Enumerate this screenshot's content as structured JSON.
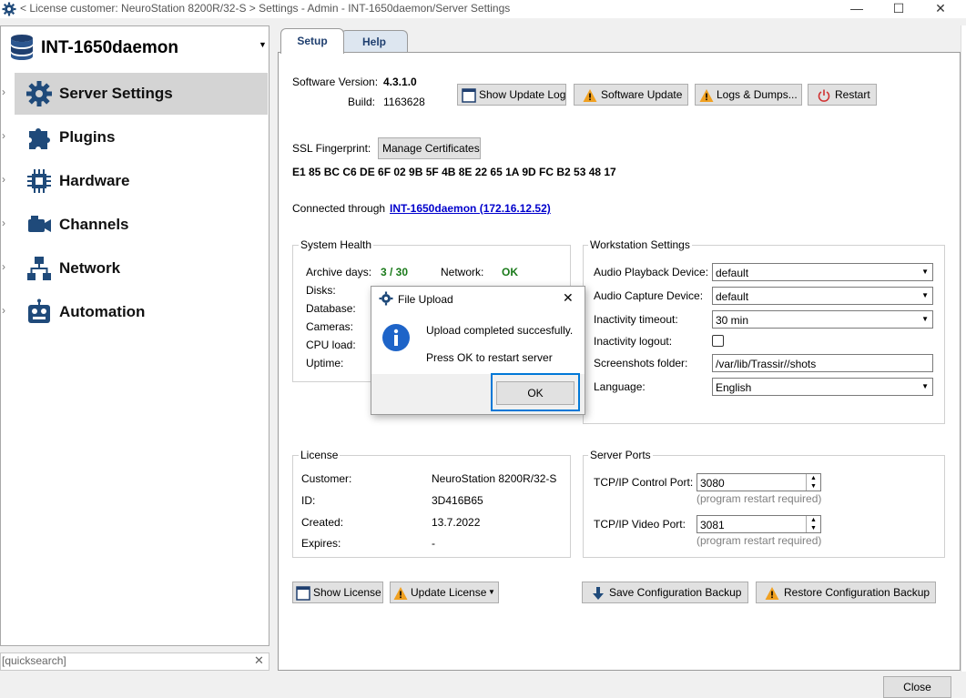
{
  "window": {
    "title": "< License customer: NeuroStation 8200R/32-S > Settings - Admin - INT-1650daemon/Server Settings",
    "minimize": "—",
    "maximize": "☐",
    "close": "✕"
  },
  "sidebar": {
    "server_name": "INT-1650daemon",
    "items": [
      {
        "label": "Server Settings",
        "icon": "gear-icon",
        "active": true
      },
      {
        "label": "Plugins",
        "icon": "puzzle-icon"
      },
      {
        "label": "Hardware",
        "icon": "chip-icon"
      },
      {
        "label": "Channels",
        "icon": "camera-icon"
      },
      {
        "label": "Network",
        "icon": "network-icon"
      },
      {
        "label": "Automation",
        "icon": "robot-icon"
      }
    ],
    "quicksearch_placeholder": "[quicksearch]",
    "quicksearch_clear": "✕"
  },
  "tabs": [
    {
      "label": "Setup",
      "active": true
    },
    {
      "label": "Help"
    }
  ],
  "setup": {
    "software_version_label": "Software Version:",
    "software_version": "4.3.1.0",
    "build_label": "Build:",
    "build": "1163628",
    "buttons": {
      "show_update_log": "Show Update Log",
      "software_update": "Software Update",
      "logs_dumps": "Logs & Dumps...",
      "restart": "Restart"
    },
    "ssl_label": "SSL Fingerprint:",
    "manage_certificates": "Manage Certificates",
    "ssl_fingerprint": "E1 85 BC C6 DE 6F 02 9B 5F 4B 8E 22 65 1A 9D FC B2 53 48 17",
    "connected_label": "Connected through",
    "connected_link": "INT-1650daemon (172.16.12.52)",
    "system_health": {
      "title": "System Health",
      "archive_days_label": "Archive days:",
      "archive_days": "3 / 30",
      "network_label": "Network:",
      "network": "OK",
      "disks_label": "Disks:",
      "database_label": "Database:",
      "cameras_label": "Cameras:",
      "cpu_label": "CPU load:",
      "uptime_label": "Uptime:"
    },
    "workstation": {
      "title": "Workstation Settings",
      "audio_playback_label": "Audio Playback Device:",
      "audio_playback": "default",
      "audio_capture_label": "Audio Capture Device:",
      "audio_capture": "default",
      "inactivity_timeout_label": "Inactivity timeout:",
      "inactivity_timeout": "30 min",
      "inactivity_logout_label": "Inactivity logout:",
      "screenshots_label": "Screenshots folder:",
      "screenshots_folder": "/var/lib/Trassir//shots",
      "language_label": "Language:",
      "language": "English"
    },
    "license": {
      "title": "License",
      "customer_label": "Customer:",
      "customer": "NeuroStation 8200R/32-S",
      "id_label": "ID:",
      "id": "3D416B65",
      "created_label": "Created:",
      "created": "13.7.2022",
      "expires_label": "Expires:",
      "expires": "-"
    },
    "ports": {
      "title": "Server Ports",
      "control_label": "TCP/IP Control Port:",
      "control_port": "3080",
      "control_hint": "(program restart required)",
      "video_label": "TCP/IP Video Port:",
      "video_port": "3081",
      "video_hint": "(program restart required)"
    },
    "bottom_buttons": {
      "show_license": "Show License",
      "update_license": "Update License",
      "save_backup": "Save Configuration Backup",
      "restore_backup": "Restore Configuration Backup"
    }
  },
  "dialog": {
    "title": "File Upload",
    "close": "✕",
    "message": "Upload completed succesfully.",
    "sub_message": "Press OK to restart server",
    "ok": "OK"
  },
  "footer": {
    "close": "Close"
  },
  "colors": {
    "accent": "#0078d7",
    "link": "#0000cc",
    "ok_green": "#1a7a1a",
    "warning": "#f0a020"
  }
}
